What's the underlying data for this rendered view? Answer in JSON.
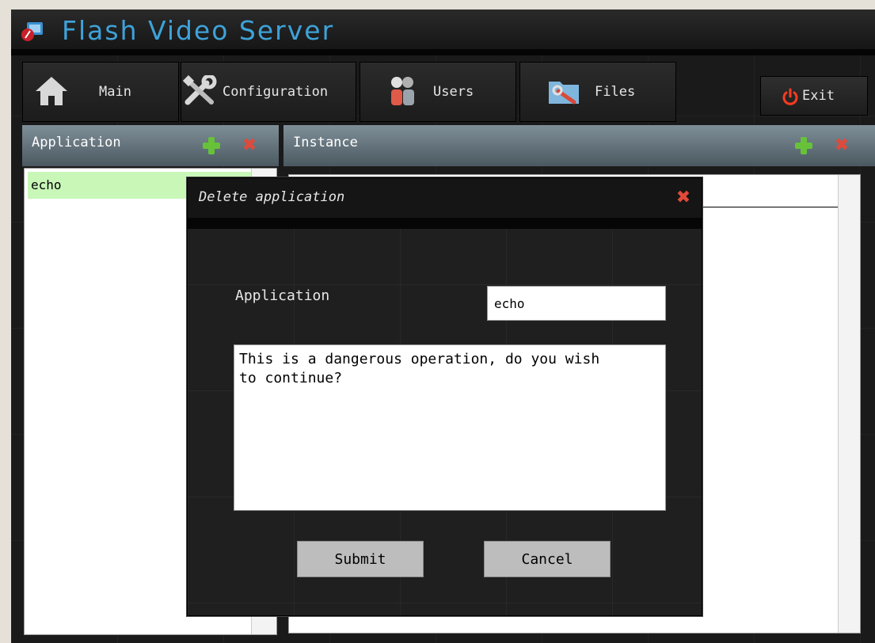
{
  "app": {
    "title": "Flash Video Server"
  },
  "nav": {
    "main_label": "Main",
    "configuration_label": "Configuration",
    "users_label": "Users",
    "files_label": "Files",
    "exit_label": "Exit"
  },
  "icons": {
    "nav_main": "house-icon",
    "nav_configuration": "tools-icon",
    "nav_users": "users-icon",
    "nav_files": "folder-wrench-icon",
    "exit": "power-icon",
    "add": "plus-icon",
    "delete": "close-icon"
  },
  "panels": {
    "application_header": "Application",
    "instance_header": "Instance",
    "applications": [
      "echo"
    ]
  },
  "dialog": {
    "title": "Delete application",
    "field_label": "Application",
    "field_value": "echo",
    "message": "This is a dangerous operation, do you wish\nto continue?",
    "submit_label": "Submit",
    "cancel_label": "Cancel"
  },
  "colors": {
    "title_blue": "#3ea2d9",
    "selected_item": "#c8f7b8",
    "add_green": "#67c23a",
    "delete_red": "#e04a3a",
    "exit_red": "#ff3b1f"
  }
}
